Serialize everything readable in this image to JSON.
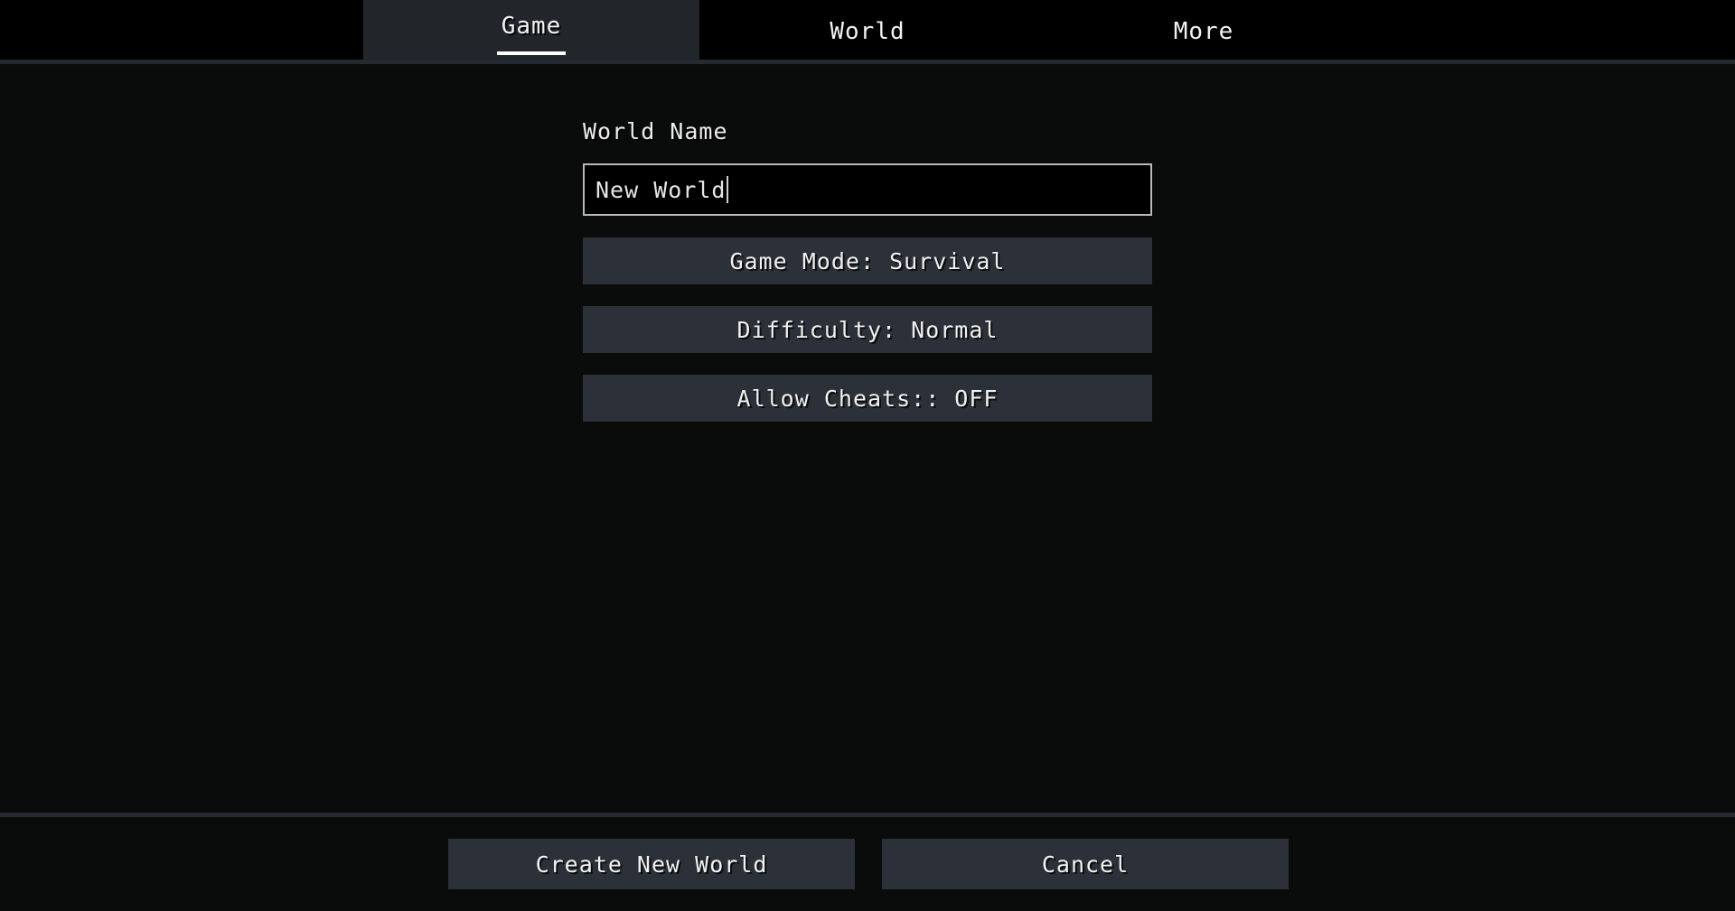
{
  "tabs": [
    {
      "label": "Game",
      "active": true
    },
    {
      "label": "World",
      "active": false
    },
    {
      "label": "More",
      "active": false
    }
  ],
  "form": {
    "world_name_label": "World Name",
    "world_name_value": "New World",
    "world_name_placeholder": "New World",
    "options": [
      {
        "label": "Game Mode: Survival",
        "setting": "Game Mode",
        "value": "Survival"
      },
      {
        "label": "Difficulty: Normal",
        "setting": "Difficulty",
        "value": "Normal"
      },
      {
        "label": "Allow Cheats:: OFF",
        "setting": "Allow Cheats",
        "value": "OFF"
      }
    ]
  },
  "footer": {
    "create_label": "Create New World",
    "cancel_label": "Cancel"
  },
  "colors": {
    "background": "#0a0b0b",
    "tab_active_bg": "#22262b",
    "button_bg": "#2c3038",
    "separator": "#252a31",
    "input_border": "#b9b9b9",
    "text": "#f2f2f2"
  }
}
